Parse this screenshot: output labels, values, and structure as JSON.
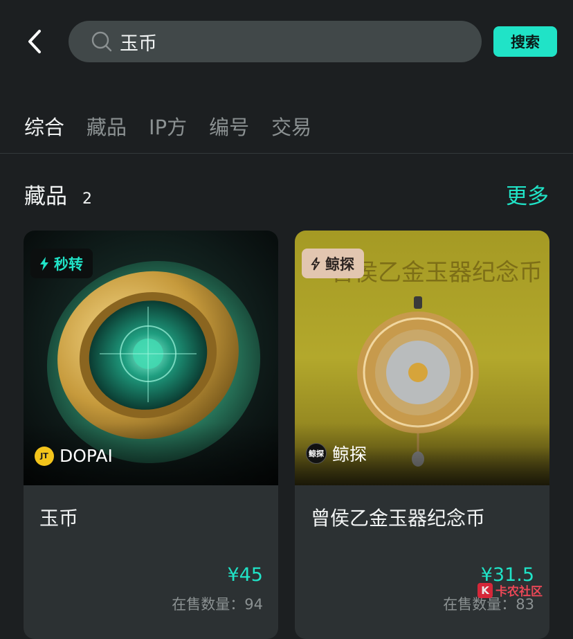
{
  "search": {
    "query": "玉币",
    "button_label": "搜索"
  },
  "tabs": [
    "综合",
    "藏品",
    "IP方",
    "编号",
    "交易"
  ],
  "section": {
    "title": "藏品",
    "count": "2",
    "more_label": "更多"
  },
  "cards": [
    {
      "badge": "秒转",
      "issuer": "DOPAI",
      "issuer_logo": "JT",
      "name": "玉币",
      "price": "¥45",
      "stock": "在售数量：94"
    },
    {
      "badge": "鲸探",
      "issuer": "鲸探",
      "issuer_logo": "鲸探",
      "image_text": "曾侯乙金玉器纪念币",
      "name": "曾侯乙金玉器纪念币",
      "price": "¥31.5",
      "stock": "在售数量：83"
    }
  ],
  "watermark": {
    "label": "卡农社区",
    "mark": "K"
  },
  "colors": {
    "accent": "#20e3c7",
    "background": "#1c1f21",
    "card": "#2c3133"
  }
}
